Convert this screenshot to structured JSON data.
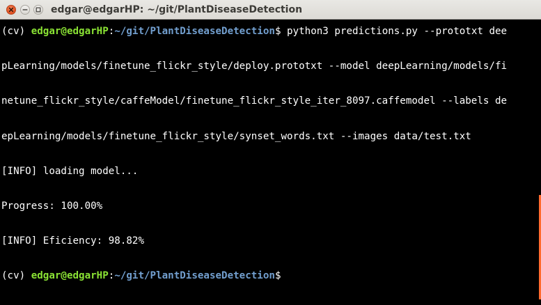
{
  "window": {
    "title": "edgar@edgarHP: ~/git/PlantDiseaseDetection"
  },
  "terminal": {
    "prompt1": {
      "env": "(cv) ",
      "user_host": "edgar@edgarHP",
      "sep": ":",
      "path": "~/git/PlantDiseaseDetection",
      "symbol": "$ ",
      "command": "python3 predictions.py --prototxt dee"
    },
    "wrapped_lines": [
      "pLearning/models/finetune_flickr_style/deploy.prototxt --model deepLearning/models/fi",
      "netune_flickr_style/caffeModel/finetune_flickr_style_iter_8097.caffemodel --labels de",
      "epLearning/models/finetune_flickr_style/synset_words.txt --images data/test.txt"
    ],
    "output_lines": [
      "[INFO] loading model...",
      "Progress: 100.00%",
      "[INFO] Eficiency: 98.82%"
    ],
    "prompt2": {
      "env": "(cv) ",
      "user_host": "edgar@edgarHP",
      "sep": ":",
      "path": "~/git/PlantDiseaseDetection",
      "symbol": "$"
    }
  },
  "colors": {
    "background": "#000000",
    "user_host": "#8ae234",
    "path": "#729fcf",
    "close_button": "#e1501f"
  },
  "icons": [
    "close-icon",
    "minimize-icon",
    "maximize-icon"
  ]
}
